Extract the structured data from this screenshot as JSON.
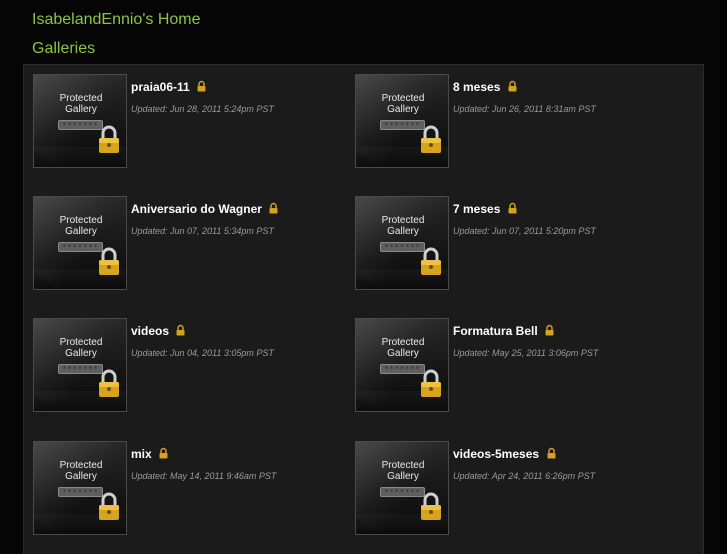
{
  "header": {
    "title": "IsabelandEnnio's Home"
  },
  "section": {
    "title": "Galleries"
  },
  "thumb_common": {
    "label_line1": "Protected",
    "label_line2": "Gallery",
    "password_mask": "*******"
  },
  "galleries": [
    {
      "name": "praia06-11",
      "updated": "Updated: Jun 28, 2011 5:24pm PST"
    },
    {
      "name": "8 meses",
      "updated": "Updated: Jun 26, 2011 8:31am PST"
    },
    {
      "name": "Aniversario do Wagner",
      "updated": "Updated: Jun 07, 2011 5:34pm PST"
    },
    {
      "name": "7 meses",
      "updated": "Updated: Jun 07, 2011 5:20pm PST"
    },
    {
      "name": "videos",
      "updated": "Updated: Jun 04, 2011 3:05pm PST"
    },
    {
      "name": "Formatura Bell",
      "updated": "Updated: May 25, 2011 3:06pm PST"
    },
    {
      "name": "mix",
      "updated": "Updated: May 14, 2011 9:46am PST"
    },
    {
      "name": "videos-5meses",
      "updated": "Updated: Apr 24, 2011 6:26pm PST"
    }
  ],
  "icons": {
    "lock": "lock-icon",
    "lock_color": "#d6a21b"
  },
  "colors": {
    "accent": "#8cc63f",
    "background": "#050505",
    "panel": "#1b1b1b"
  }
}
